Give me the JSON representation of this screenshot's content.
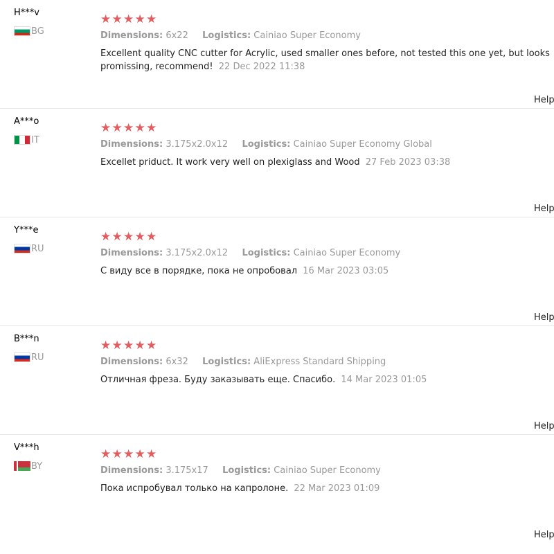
{
  "labels": {
    "dimensions": "Dimensions:",
    "logistics": "Logistics:",
    "helpful": "Helpful?"
  },
  "reviews": [
    {
      "username": "H***v",
      "country": "BG",
      "flag": "bulgaria-flag-icon",
      "rating": 5,
      "dimensions": "6x22",
      "logistics": "Cainiao Super Economy",
      "text": "Excellent quality CNC cutter for Acrylic, used smaller ones before, not tested this one yet, but looks promissing, recommend!",
      "date": "22 Dec 2022 11:38"
    },
    {
      "username": "A***o",
      "country": "IT",
      "flag": "italy-flag-icon",
      "rating": 5,
      "dimensions": "3.175x2.0x12",
      "logistics": "Cainiao Super Economy Global",
      "text": "Excellet priduct. It work very well on plexiglass and Wood",
      "date": "27 Feb 2023 03:38"
    },
    {
      "username": "Y***e",
      "country": "RU",
      "flag": "russia-flag-icon",
      "rating": 5,
      "dimensions": "3.175x2.0x12",
      "logistics": "Cainiao Super Economy",
      "text": "С виду все в порядке, пока не опробовал",
      "date": "16 Mar 2023 03:05"
    },
    {
      "username": "B***n",
      "country": "RU",
      "flag": "russia-flag-icon",
      "rating": 5,
      "dimensions": "6x32",
      "logistics": "AliExpress Standard Shipping",
      "text": "Отличная фреза. Буду заказывать еще. Спасибо.",
      "date": "14 Mar 2023 01:05"
    },
    {
      "username": "V***h",
      "country": "BY",
      "flag": "belarus-flag-icon",
      "rating": 5,
      "dimensions": "3.175x17",
      "logistics": "Cainiao Super Economy",
      "text": "Пока испробувал только на капролоне.",
      "date": "22 Mar 2023 01:09"
    }
  ],
  "colors": {
    "star": "#e25d5f",
    "muted": "#999999",
    "divider": "#e6e6e6"
  }
}
